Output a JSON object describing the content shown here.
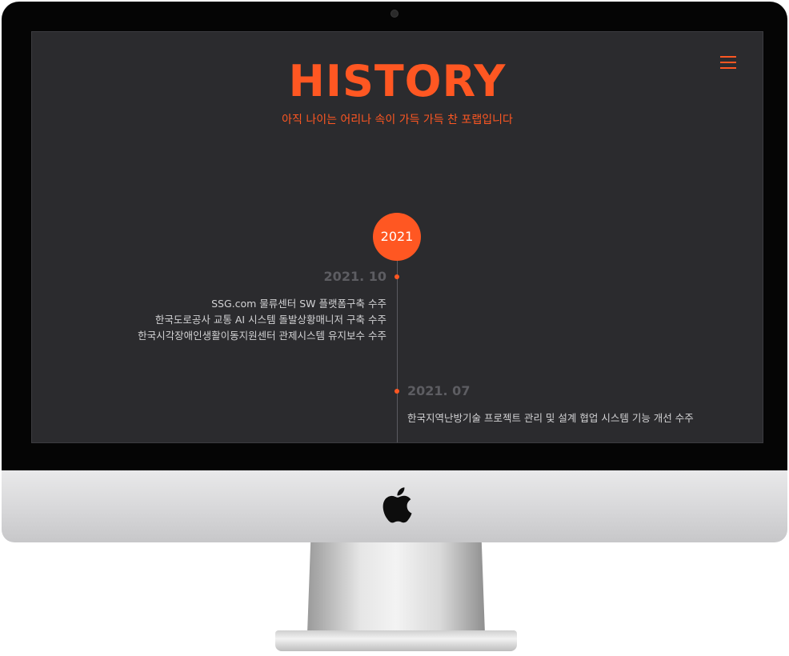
{
  "colors": {
    "accent": "#ff5722",
    "background": "#2b2b2e",
    "muted_date": "#5d5d62",
    "text": "#d2d2d4"
  },
  "header": {
    "title": "HISTORY",
    "subtitle": "아직 나이는 어리나 속이 가득 가득 찬 포랩입니다",
    "menu_icon": "hamburger-menu-icon"
  },
  "timeline": {
    "year": "2021",
    "entries": [
      {
        "date": "2021. 10",
        "items": [
          "SSG.com 물류센터 SW 플랫폼구축 수주",
          "한국도로공사 교통 AI 시스템 돌발상황매니저 구축 수주",
          "한국시각장애인생활이동지원센터 관제시스템 유지보수 수주"
        ]
      },
      {
        "date": "2021. 07",
        "items": [
          "한국지역난방기술 프로젝트 관리 및 설계 협업 시스템 기능 개선 수주"
        ]
      }
    ]
  },
  "device": {
    "logo": "apple-logo-icon"
  }
}
